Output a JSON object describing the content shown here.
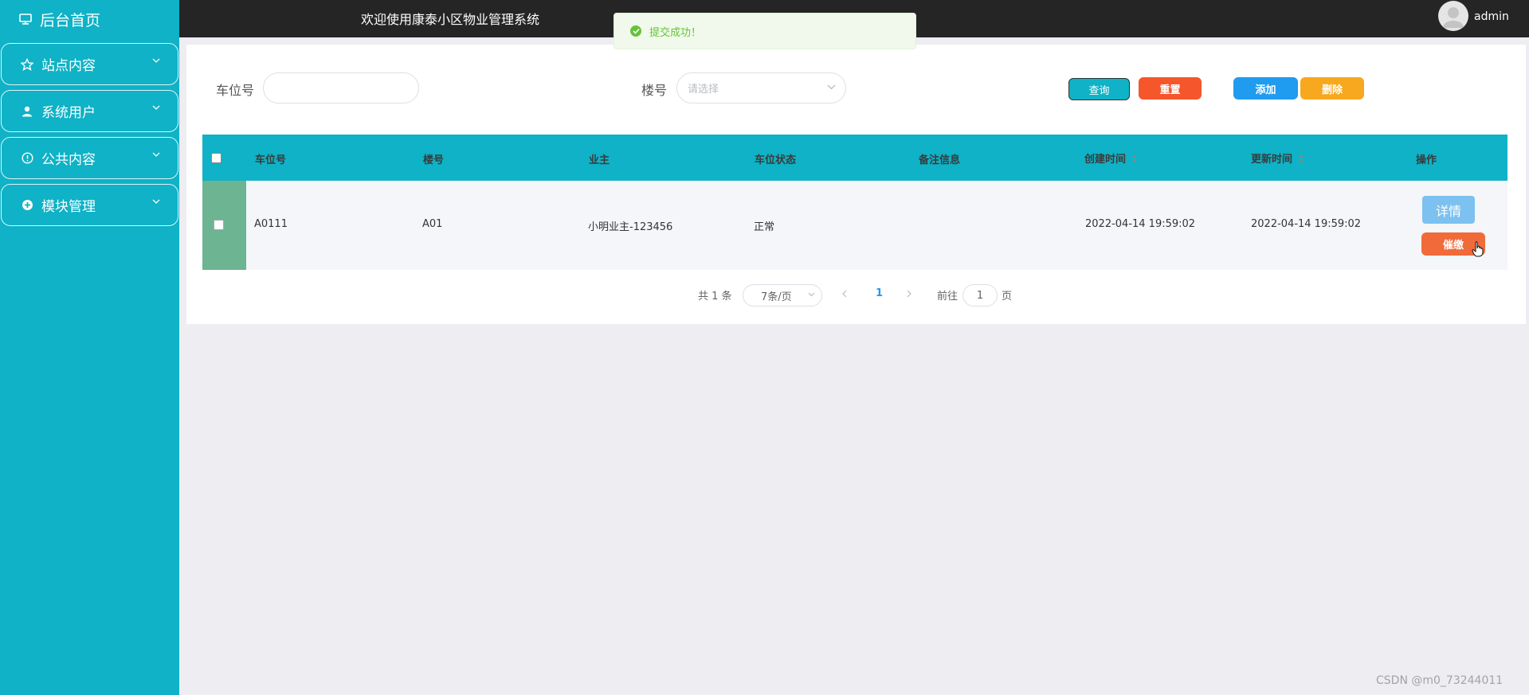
{
  "sidebar": {
    "home_label": "后台首页",
    "items": [
      {
        "label": "站点内容",
        "icon": "star-icon"
      },
      {
        "label": "系统用户",
        "icon": "user-icon"
      },
      {
        "label": "公共内容",
        "icon": "info-icon"
      },
      {
        "label": "模块管理",
        "icon": "plus-circle-icon"
      }
    ]
  },
  "header": {
    "title": "欢迎使用康泰小区物业管理系统",
    "username": "admin"
  },
  "toast": {
    "message": "提交成功！",
    "color": "#67c23a"
  },
  "search": {
    "parking_label": "车位号",
    "parking_value": "",
    "building_label": "楼号",
    "building_placeholder": "请选择",
    "query_label": "查询",
    "reset_label": "重置",
    "add_label": "添加",
    "delete_label": "删除"
  },
  "table": {
    "columns": [
      "车位号",
      "楼号",
      "业主",
      "车位状态",
      "备注信息",
      "创建时间",
      "更新时间",
      "操作"
    ],
    "rows": [
      {
        "parking_no": "A0111",
        "building": "A01",
        "owner": "小明业主-123456",
        "status": "正常",
        "remark": "",
        "created": "2022-04-14 19:59:02",
        "updated": "2022-04-14 19:59:02",
        "detail_label": "详情",
        "remind_label": "催缴"
      }
    ]
  },
  "pagination": {
    "total_text": "共 1 条",
    "page_size": "7条/页",
    "current_page": "1",
    "goto_label": "前往",
    "goto_value": "1",
    "page_suffix": "页"
  },
  "watermark": "CSDN @m0_73244011",
  "colors": {
    "sidebar": "#0fb2c6",
    "topbar": "#252525",
    "reset": "#f5562b",
    "add": "#1f9bf0",
    "delete": "#f7a81e",
    "remind": "#f06a3a",
    "detail": "#7cc1ef"
  }
}
